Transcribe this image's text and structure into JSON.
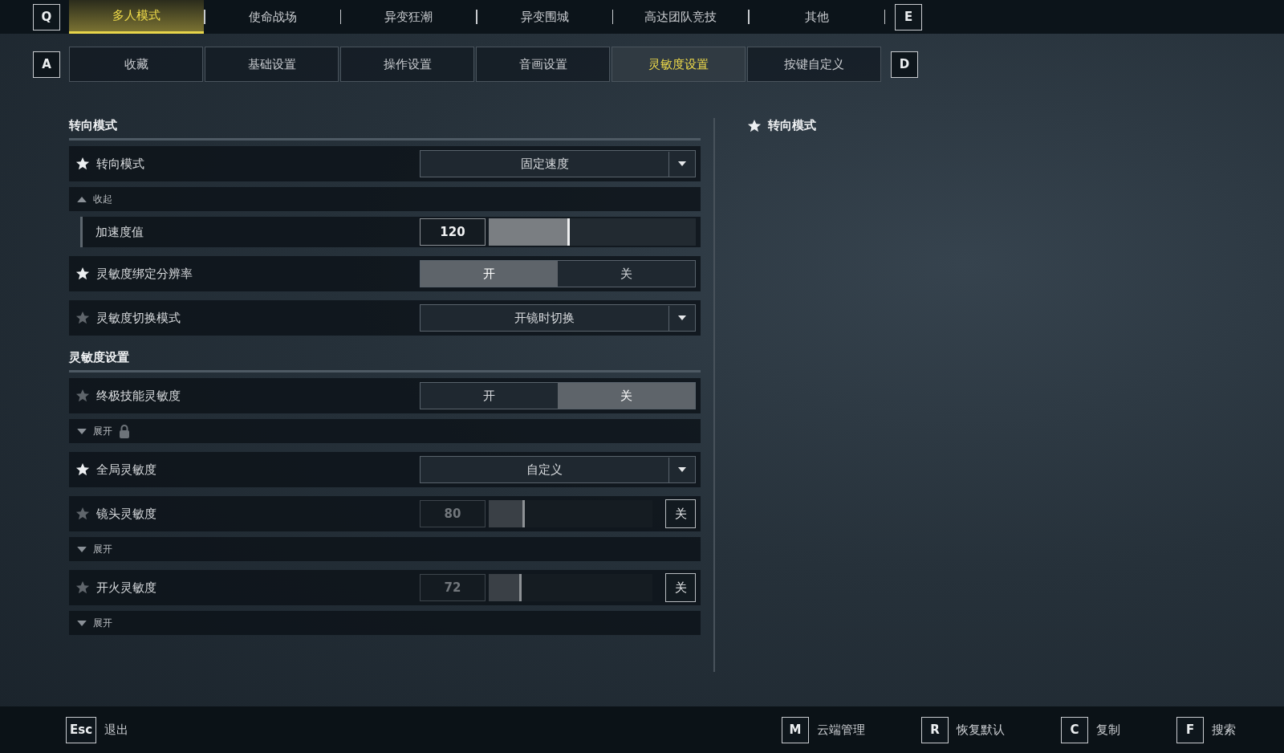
{
  "top_nav": {
    "prev_key": "Q",
    "next_key": "E",
    "tabs": [
      {
        "label": "多人模式",
        "selected": true
      },
      {
        "label": "使命战场",
        "selected": false
      },
      {
        "label": "异变狂潮",
        "selected": false
      },
      {
        "label": "异变围城",
        "selected": false
      },
      {
        "label": "高达团队竞技",
        "selected": false
      },
      {
        "label": "其他",
        "selected": false
      }
    ]
  },
  "sub_nav": {
    "prev_key": "A",
    "next_key": "D",
    "tabs": [
      {
        "label": "收藏",
        "selected": false
      },
      {
        "label": "基础设置",
        "selected": false
      },
      {
        "label": "操作设置",
        "selected": false
      },
      {
        "label": "音画设置",
        "selected": false
      },
      {
        "label": "灵敏度设置",
        "selected": true
      },
      {
        "label": "按键自定义",
        "selected": false
      }
    ]
  },
  "sections": [
    {
      "title": "转向模式",
      "rows": [
        {
          "kind": "dropdown",
          "label": "转向模式",
          "favorite": true,
          "value": "固定速度"
        },
        {
          "kind": "expander",
          "label": "收起",
          "expanded": true,
          "locked": false,
          "children": [
            {
              "kind": "slider",
              "label": "加速度值",
              "value": "120",
              "level": 0.39,
              "disabled": false
            }
          ]
        },
        {
          "kind": "toggle",
          "label": "灵敏度绑定分辨率",
          "favorite": true,
          "options": [
            {
              "label": "开",
              "selected": true
            },
            {
              "label": "关",
              "selected": false
            }
          ]
        },
        {
          "kind": "dropdown",
          "label": "灵敏度切换模式",
          "favorite": false,
          "value": "开镜时切换"
        }
      ]
    },
    {
      "title": "灵敏度设置",
      "rows": [
        {
          "kind": "toggle",
          "label": "终极技能灵敏度",
          "favorite": false,
          "options": [
            {
              "label": "开",
              "selected": false
            },
            {
              "label": "关",
              "selected": true
            }
          ]
        },
        {
          "kind": "expander",
          "label": "展开",
          "expanded": false,
          "locked": true
        },
        {
          "kind": "dropdown",
          "label": "全局灵敏度",
          "favorite": true,
          "value": "自定义"
        },
        {
          "kind": "slider",
          "label": "镜头灵敏度",
          "favorite": false,
          "value": "80",
          "level": 0.22,
          "disabled": true,
          "off_button": "关"
        },
        {
          "kind": "expander",
          "label": "展开",
          "expanded": false,
          "locked": false
        },
        {
          "kind": "slider",
          "label": "开火灵敏度",
          "favorite": false,
          "value": "72",
          "level": 0.2,
          "disabled": true,
          "off_button": "关"
        },
        {
          "kind": "expander",
          "label": "展开",
          "expanded": false,
          "locked": false
        }
      ]
    }
  ],
  "side_panel": {
    "title": "转向模式"
  },
  "footer": {
    "left": [
      {
        "key": "Esc",
        "label": "退出"
      }
    ],
    "right": [
      {
        "key": "M",
        "label": "云端管理"
      },
      {
        "key": "R",
        "label": "恢复默认"
      },
      {
        "key": "C",
        "label": "复制"
      },
      {
        "key": "F",
        "label": "搜索"
      }
    ]
  }
}
